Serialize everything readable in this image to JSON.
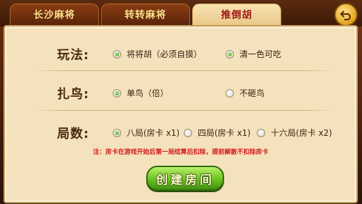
{
  "tabs": [
    {
      "label": "长沙麻将",
      "active": false
    },
    {
      "label": "转转麻将",
      "active": false
    },
    {
      "label": "推倒胡",
      "active": true
    }
  ],
  "back_icon": "back-arrow-icon",
  "rows": {
    "play": {
      "label": "玩法:",
      "options": [
        {
          "label": "将将胡（必须自摸）",
          "checked": true
        },
        {
          "label": "清一色可吃",
          "checked": true
        }
      ]
    },
    "bird": {
      "label": "扎鸟:",
      "options": [
        {
          "label": "单鸟（倍）",
          "checked": true
        },
        {
          "label": "不砸鸟",
          "checked": false
        }
      ]
    },
    "rounds": {
      "label": "局数:",
      "options": [
        {
          "label": "八局(房卡 x1)",
          "checked": true
        },
        {
          "label": "四局(房卡 x1)",
          "checked": false
        },
        {
          "label": "十六局(房卡 x2)",
          "checked": false
        }
      ]
    }
  },
  "note": "注：房卡在游戏开始后第一局结算后扣除，提前解散不扣除房卡",
  "create_button": "创建房间",
  "colors": {
    "accent_red": "#d11a1a",
    "button_green": "#6cc21f",
    "panel": "#f4e2bd"
  }
}
